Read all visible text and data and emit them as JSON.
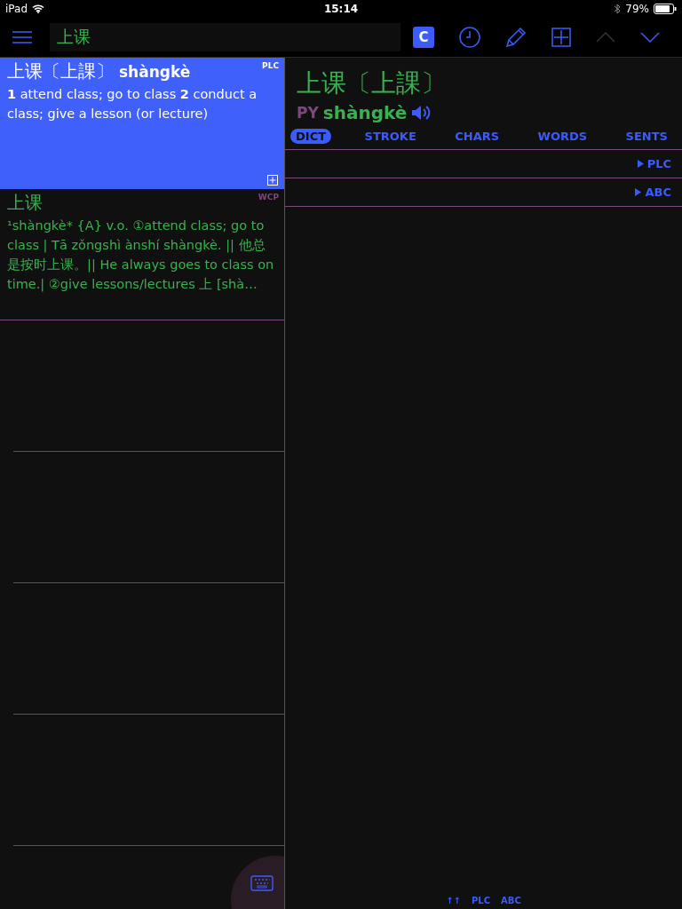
{
  "status_bar": {
    "device": "iPad",
    "time": "15:14",
    "battery": "79%"
  },
  "search": {
    "value": "上课"
  },
  "toolbar": [
    {
      "kind": "c",
      "label": "C",
      "selected": true
    },
    {
      "kind": "history",
      "disabled": false
    },
    {
      "kind": "pencil",
      "disabled": false
    },
    {
      "kind": "add",
      "disabled": false
    },
    {
      "kind": "up",
      "disabled": true
    },
    {
      "kind": "down",
      "disabled": false
    }
  ],
  "results": [
    {
      "selected": true,
      "source": "PLC",
      "headword": "上课〔上課〕",
      "pinyin": "shàngkè",
      "definition": "**1** attend class; go to class  **2** conduct a class; give a lesson (or lecture)"
    },
    {
      "selected": false,
      "source": "WCP",
      "headword": "上课",
      "definition": "¹shàngkè* {A} v.o. ①attend class; go to class | Tā zǒngshì ànshí shàngkè. || 他总是按时上课。|| He always goes to class on time.| ②give lessons/lectures  上 [shà…"
    }
  ],
  "detail": {
    "headword": "上课〔上課〕",
    "pinyin_label": "PY",
    "pinyin": "shàngkè",
    "tabs": [
      {
        "label": "DICT",
        "selected": true
      },
      {
        "label": "STROKE",
        "selected": false
      },
      {
        "label": "CHARS",
        "selected": false
      },
      {
        "label": "WORDS",
        "selected": false
      },
      {
        "label": "SENTS",
        "selected": false
      }
    ],
    "sections": [
      {
        "label": "PLC",
        "expanded": false
      },
      {
        "label": "ABC",
        "expanded": false
      }
    ],
    "footer": [
      "↑↑",
      "PLC",
      "ABC"
    ]
  }
}
